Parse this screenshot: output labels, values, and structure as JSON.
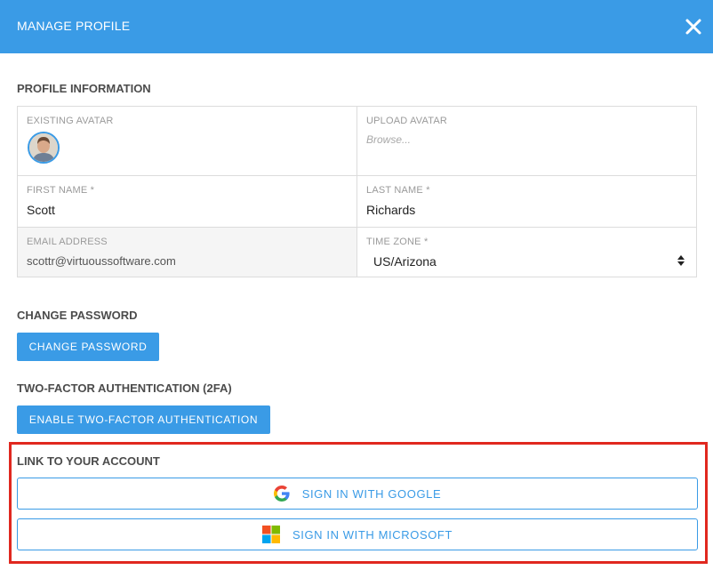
{
  "header": {
    "title": "MANAGE PROFILE"
  },
  "profile": {
    "section_title": "PROFILE INFORMATION",
    "existing_avatar_label": "EXISTING AVATAR",
    "upload_avatar_label": "UPLOAD AVATAR",
    "upload_placeholder": "Browse...",
    "first_name_label": "FIRST NAME *",
    "first_name": "Scott",
    "last_name_label": "LAST NAME *",
    "last_name": "Richards",
    "email_label": "EMAIL ADDRESS",
    "email": "scottr@virtuoussoftware.com",
    "timezone_label": "TIME ZONE *",
    "timezone": "US/Arizona"
  },
  "password": {
    "section_title": "CHANGE PASSWORD",
    "button_label": "CHANGE PASSWORD"
  },
  "twofa": {
    "section_title": "TWO-FACTOR AUTHENTICATION (2FA)",
    "button_label": "ENABLE TWO-FACTOR AUTHENTICATION"
  },
  "link": {
    "section_title": "LINK TO YOUR ACCOUNT",
    "google_label": "SIGN IN WITH GOOGLE",
    "microsoft_label": "SIGN IN WITH MICROSOFT"
  },
  "colors": {
    "accent": "#3a9be6",
    "highlight": "#e0281f"
  },
  "icons": {
    "close": "close-icon",
    "google": "google-icon",
    "microsoft": "microsoft-icon",
    "select": "select-arrows-icon"
  }
}
